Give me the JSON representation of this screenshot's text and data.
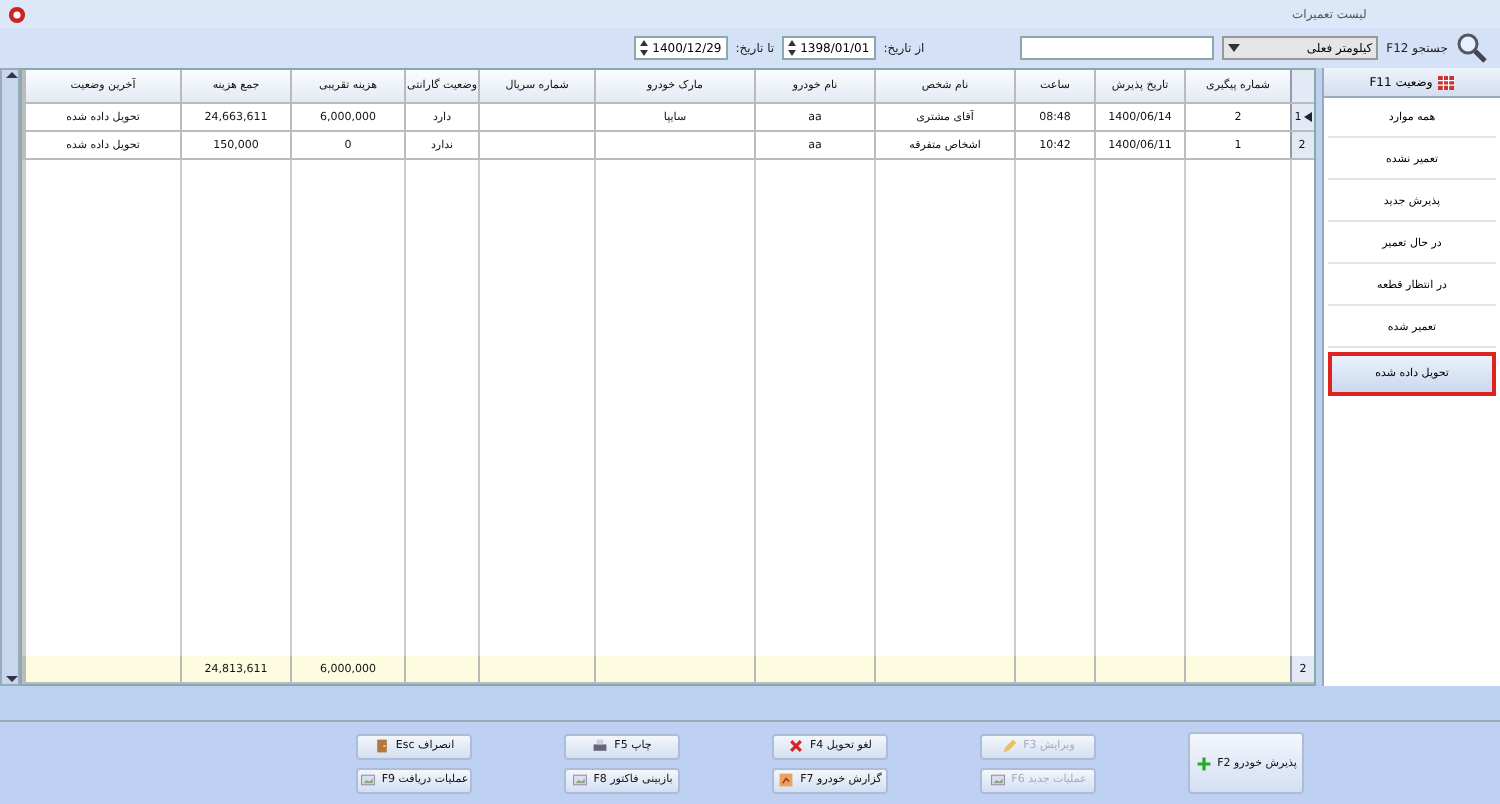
{
  "window": {
    "title": "لیست تعمیرات"
  },
  "filters": {
    "search_label": "جستجو F12",
    "field_selector": "کیلومتر فعلی",
    "from_label": "از تاریخ:",
    "from_date": "1398/01/01",
    "to_label": "تا تاریخ:",
    "to_date": "1400/12/29"
  },
  "table": {
    "columns": [
      "شماره پیگیری",
      "تاریخ پذیرش",
      "ساعت",
      "نام شخص",
      "نام خودرو",
      "مارک خودرو",
      "شماره سریال",
      "وضعیت گارانتی",
      "هزینه تقریبی",
      "جمع هزینه",
      "آخرین وضعیت"
    ],
    "rows": [
      {
        "row_number": "1",
        "current": true,
        "cells": [
          "2",
          "1400/06/14",
          "08:48",
          "آقای مشتری",
          "aa",
          "سایپا",
          null,
          "دارد",
          "6,000,000",
          "24,663,611",
          "تحویل داده شده"
        ]
      },
      {
        "row_number": "2",
        "current": false,
        "cells": [
          "1",
          "1400/06/11",
          "10:42",
          "اشخاص متفرقه",
          "aa",
          null,
          null,
          "ندارد",
          "0",
          "150,000",
          "تحویل داده شده"
        ]
      }
    ],
    "totals": {
      "row_count": "2",
      "cells": [
        null,
        null,
        null,
        null,
        null,
        null,
        null,
        null,
        "6,000,000",
        "24,813,611",
        null
      ]
    }
  },
  "sidebar": {
    "title": "وضعیت F11",
    "items": [
      {
        "label": "همه موارد",
        "selected": false
      },
      {
        "label": "تعمیر نشده",
        "selected": false
      },
      {
        "label": "پذیرش جدید",
        "selected": false
      },
      {
        "label": "در حال تعمیر",
        "selected": false
      },
      {
        "label": "در انتظار قطعه",
        "selected": false
      },
      {
        "label": "تعمیر شده",
        "selected": false
      },
      {
        "label": "تحویل داده شده",
        "selected": true
      }
    ]
  },
  "buttons": [
    {
      "label": "پذیرش خودرو F2",
      "disabled": false
    },
    {
      "label": "ویرایش F3",
      "disabled": true
    },
    {
      "label": "عملیات جدید F6",
      "disabled": true
    },
    {
      "label": "لغو تحویل F4",
      "disabled": false
    },
    {
      "label": "گزارش خودرو F7",
      "disabled": false
    },
    {
      "label": "چاپ F5",
      "disabled": false
    },
    {
      "label": "بازبینی فاکتور F8",
      "disabled": false
    },
    {
      "label": "انصراف Esc",
      "disabled": false
    },
    {
      "label": "عملیات دریافت F9",
      "disabled": false
    }
  ]
}
